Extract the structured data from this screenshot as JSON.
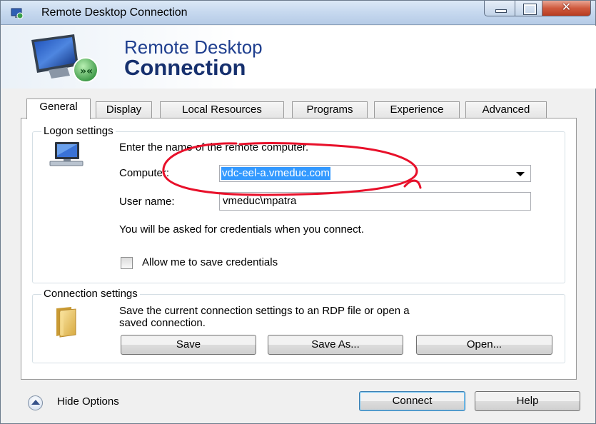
{
  "window": {
    "title": "Remote Desktop Connection"
  },
  "banner": {
    "line1": "Remote Desktop",
    "line2": "Connection"
  },
  "tabs": [
    {
      "label": "General",
      "active": true
    },
    {
      "label": "Display",
      "active": false
    },
    {
      "label": "Local Resources",
      "active": false
    },
    {
      "label": "Programs",
      "active": false
    },
    {
      "label": "Experience",
      "active": false
    },
    {
      "label": "Advanced",
      "active": false
    }
  ],
  "logon": {
    "group_label": "Logon settings",
    "instruction": "Enter the name of the remote computer.",
    "computer_label": "Computer:",
    "computer_value": "vdc-eel-a.vmeduc.com",
    "username_label": "User name:",
    "username_value": "vmeduc\\mpatra",
    "credentials_note": "You will be asked for credentials when you connect.",
    "save_credentials_label": "Allow me to save credentials",
    "save_credentials_checked": false
  },
  "connection": {
    "group_label": "Connection settings",
    "description_line1": "Save the current connection settings to an RDP file or open a",
    "description_line2": "saved connection.",
    "save_button": "Save",
    "save_as_button": "Save As...",
    "open_button": "Open..."
  },
  "footer": {
    "hide_options": "Hide Options",
    "connect_button": "Connect",
    "help_button": "Help"
  },
  "colors": {
    "selection": "#3399ff",
    "annotation": "#e8102a",
    "banner_text": "#1f3f8f"
  },
  "icons": [
    "rdp-app-icon",
    "remote-desktop-logo",
    "computer-icon",
    "folder-icon",
    "chevron-up-icon",
    "dropdown-arrow-icon"
  ]
}
